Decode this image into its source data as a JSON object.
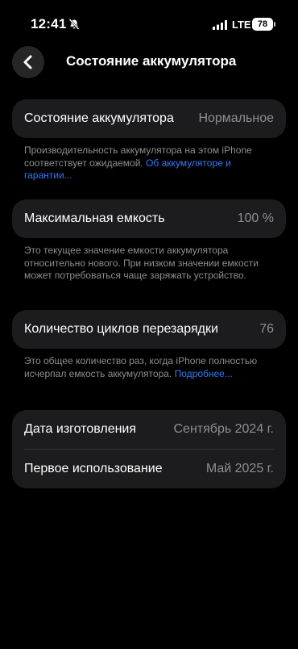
{
  "status_bar": {
    "time": "12:41",
    "network": "LTE",
    "battery": "78"
  },
  "header": {
    "title": "Состояние аккумулятора"
  },
  "battery_health": {
    "label": "Состояние аккумулятора",
    "value": "Нормальное",
    "note": "Производительность аккумулятора на этом iPhone соответствует ожидаемой.",
    "link": "Об аккумуляторе и гарантии..."
  },
  "max_capacity": {
    "label": "Максимальная емкость",
    "value": "100 %",
    "note": "Это текущее значение емкости аккумулятора относительно нового. При низком значении емкости может потребоваться чаще заряжать устройство."
  },
  "cycle_count": {
    "label": "Количество циклов перезарядки",
    "value": "76",
    "note": "Это общее количество раз, когда iPhone полностью исчерпал емкость аккумулятора.",
    "link": "Подробнее..."
  },
  "dates": {
    "manufacture_label": "Дата изготовления",
    "manufacture_value": "Сентябрь 2024 г.",
    "first_use_label": "Первое использование",
    "first_use_value": "Май 2025 г."
  }
}
